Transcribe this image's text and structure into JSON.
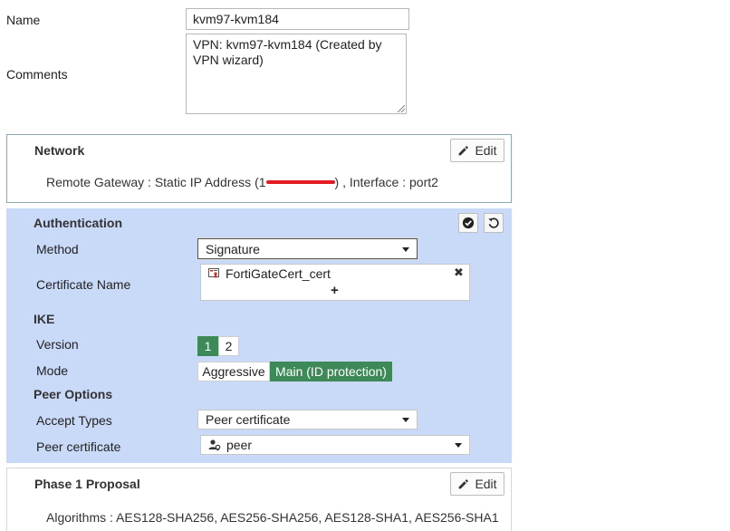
{
  "name": {
    "label": "Name",
    "value": "kvm97-kvm184"
  },
  "comments": {
    "label": "Comments",
    "value": "VPN: kvm97-kvm184 (Created by VPN wizard)"
  },
  "network": {
    "title": "Network",
    "edit_label": "Edit",
    "remote_gateway_prefix": "Remote Gateway : Static IP Address (",
    "remote_gateway_ip_fragment": "1",
    "remote_gateway_suffix": ") , Interface : port2"
  },
  "authentication": {
    "title": "Authentication",
    "method_label": "Method",
    "method_value": "Signature",
    "certificate_label": "Certificate Name",
    "certificate_value": "FortiGateCert_cert",
    "add_symbol": "+",
    "remove_symbol": "✖",
    "ike_title": "IKE",
    "version_label": "Version",
    "versions": [
      "1",
      "2"
    ],
    "version_selected": "1",
    "mode_label": "Mode",
    "modes": [
      "Aggressive",
      "Main (ID protection)"
    ],
    "mode_selected": "Main (ID protection)",
    "peer_options_title": "Peer Options",
    "accept_types_label": "Accept Types",
    "accept_types_value": "Peer certificate",
    "peer_certificate_label": "Peer certificate",
    "peer_certificate_value": "peer"
  },
  "phase1": {
    "title": "Phase 1 Proposal",
    "edit_label": "Edit",
    "algorithms": "Algorithms : AES128-SHA256, AES256-SHA256, AES128-SHA1, AES256-SHA1"
  },
  "colors": {
    "auth_bg": "#c9d9f8",
    "active_green": "#3d8a58",
    "network_border": "#8aa9b5",
    "redaction": "#e31b23"
  }
}
